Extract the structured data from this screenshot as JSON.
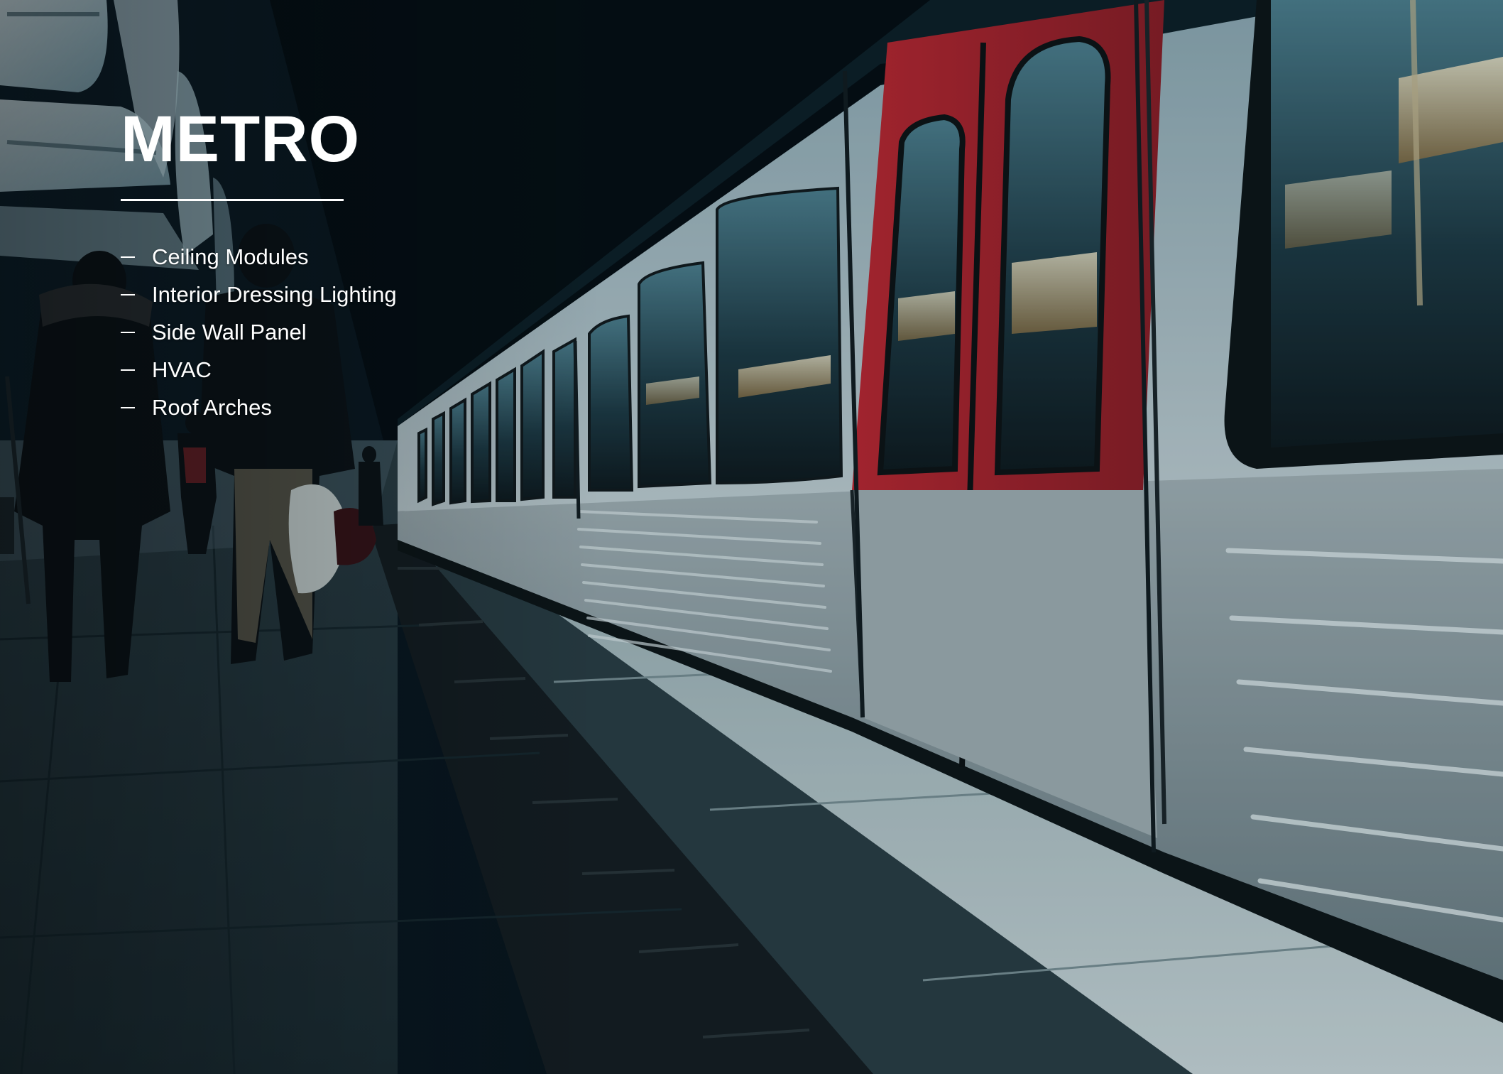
{
  "title": "METRO",
  "list": [
    {
      "label": "Ceiling Modules"
    },
    {
      "label": "Interior Dressing Lighting"
    },
    {
      "label": "Side Wall Panel"
    },
    {
      "label": "HVAC"
    },
    {
      "label": "Roof Arches"
    }
  ],
  "colors": {
    "text": "#ffffff",
    "door_accent": "#b5212a",
    "train_body": "#b9c2c6",
    "platform_dark": "#25353b",
    "platform_light": "#c9d4d6"
  }
}
